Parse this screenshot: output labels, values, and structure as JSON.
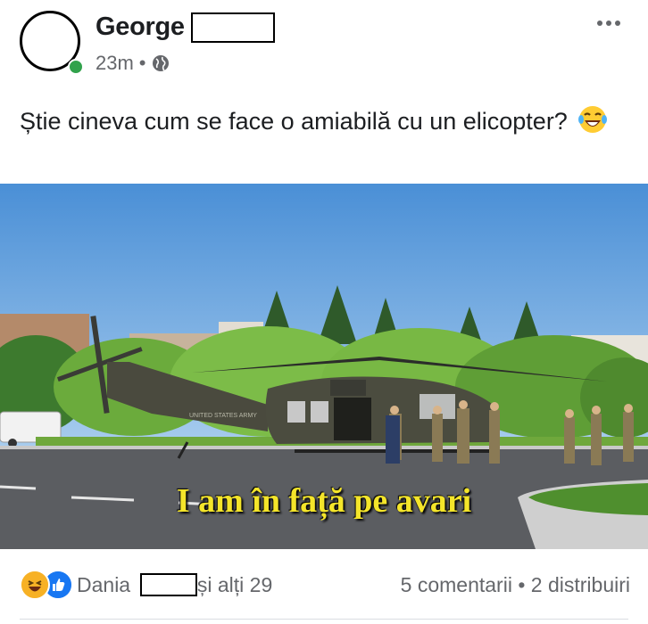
{
  "post": {
    "author": "George",
    "time": "23m",
    "separator": "•",
    "privacy_icon": "globe-icon",
    "text": "Știe cineva cum se face o amiabilă cu un elicopter?",
    "emoji": "laughing-tears-emoji"
  },
  "photo": {
    "caption": "I am în față pe avari",
    "helicopter_text": "UNITED STATES ARMY"
  },
  "footer": {
    "reaction_icons": [
      "haha-reaction-icon",
      "like-reaction-icon"
    ],
    "reactor_name": "Dania",
    "others": "și alți 29",
    "comments": "5 comentarii",
    "dot": "•",
    "shares": "2 distribuiri"
  },
  "colors": {
    "online": "#31a24c",
    "like": "#1877f2",
    "haha": "#f7b125",
    "caption": "#f4e52a"
  }
}
